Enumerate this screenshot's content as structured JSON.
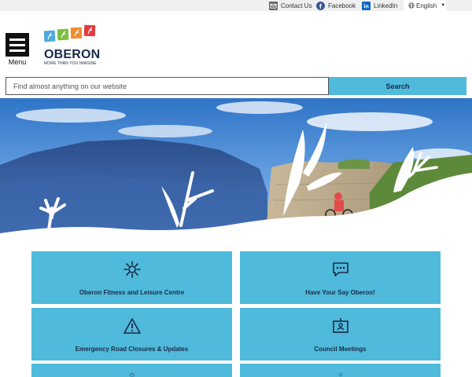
{
  "utility": {
    "contact_label": "Contact Us",
    "facebook_label": "Facebook",
    "linkedin_label": "LinkedIn",
    "language_label": "English"
  },
  "header": {
    "menu_label": "Menu",
    "logo_name": "OBERON",
    "logo_tagline": "MORE THAN YOU IMAGINE"
  },
  "search": {
    "placeholder": "Find almost anything on our website",
    "button_label": "Search"
  },
  "tiles": [
    {
      "label": "Oberon Fitness and Leisure Centre",
      "icon": "fitness-sun-icon"
    },
    {
      "label": "Have Your Say Oberon!",
      "icon": "speech-bubble-icon"
    },
    {
      "label": "Emergency Road Closures & Updates",
      "icon": "warning-triangle-icon"
    },
    {
      "label": "Council Meetings",
      "icon": "meeting-presenter-icon"
    },
    {
      "label": "",
      "icon": "briefcase-icon"
    },
    {
      "label": "",
      "icon": "circle-icon"
    }
  ],
  "colors": {
    "accent": "#4fbadb",
    "navy": "#1a2a47",
    "logo_blue": "#4fa9d9",
    "logo_green": "#7cbf3f",
    "logo_orange": "#f28b30",
    "logo_red": "#e53a40"
  }
}
